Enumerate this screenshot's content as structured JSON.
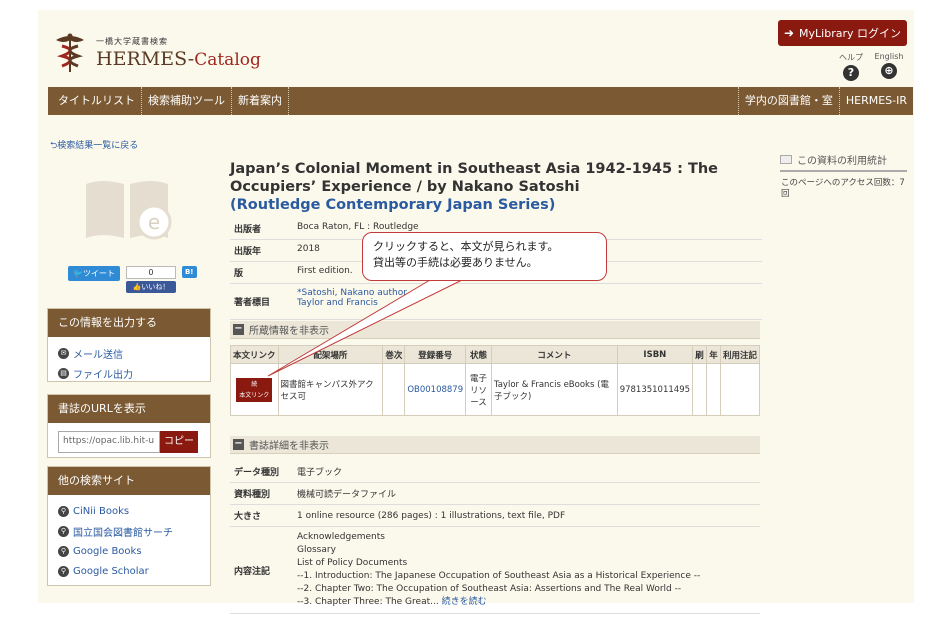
{
  "header": {
    "logo_sub": "一橋大学蔵書検索",
    "logo_main": "HERMES-",
    "logo_cat": "Catalog",
    "mylibrary_label": "MyLibrary ログイン",
    "help_label": "ヘルプ",
    "english_label": "English"
  },
  "nav": {
    "items": [
      "タイトルリスト",
      "検索補助ツール",
      "新着案内"
    ],
    "right_items": [
      "学内の図書館・室",
      "HERMES-IR"
    ]
  },
  "back_link": "検索結果一覧に戻る",
  "social": {
    "tweet": "ツイート",
    "like_count": "0",
    "like": "いいね！",
    "bookmark": "B!"
  },
  "export_panel": {
    "title": "この情報を出力する",
    "email": "メール送信",
    "file": "ファイル出力"
  },
  "url_panel": {
    "title": "書誌のURLを表示",
    "url": "https://opac.lib.hit-u",
    "copy": "コピー"
  },
  "other_panel": {
    "title": "他の検索サイト",
    "links": [
      "CiNii Books",
      "国立国会図書館サーチ",
      "Google Books",
      "Google Scholar"
    ]
  },
  "record": {
    "title": "Japan’s Colonial Moment in Southeast Asia 1942-1945 : The Occupiers’ Experience / by Nakano Satoshi",
    "series": "(Routledge Contemporary Japan Series)",
    "meta": [
      {
        "key": "出版者",
        "value": "Boca Raton, FL : Routledge"
      },
      {
        "key": "出版年",
        "value": "2018"
      },
      {
        "key": "版",
        "value": "First edition."
      }
    ],
    "author_key": "著者標目",
    "authors": [
      "*Satoshi, Nakano author",
      "Taylor and Francis"
    ]
  },
  "holdings": {
    "section_label": "所蔵情報を非表示",
    "headers": [
      "本文リンク",
      "配架場所",
      "巻次",
      "登録番号",
      "状態",
      "コメント",
      "ISBN",
      "刷",
      "年",
      "利用注記"
    ],
    "fulltext_button": "本文リンク",
    "fulltext_icon_label": "続",
    "row": {
      "location": "図書館キャンパス外アクセス可",
      "volume": "",
      "reg_no": "OB00108879",
      "status": "電子リソース",
      "comment": "Taylor & Francis eBooks (電子ブック)",
      "isbn": "9781351011495",
      "print": "",
      "year": "",
      "note": ""
    }
  },
  "details": {
    "section_label": "書誌詳細を非表示",
    "rows": [
      {
        "key": "データ種別",
        "value": "電子ブック"
      },
      {
        "key": "資料種別",
        "value": "機械可読データファイル"
      },
      {
        "key": "大きさ",
        "value": "1 online resource (286 pages) : 1 illustrations, text file, PDF"
      }
    ],
    "contents_key": "内容注記",
    "contents": [
      "Acknowledgements",
      "Glossary",
      "List of Policy Documents",
      "--1. Introduction: The Japanese Occupation of Southeast Asia as a Historical Experience --",
      "--2. Chapter Two: The Occupation of Southeast Asia: Assertions and The Real World --",
      "--3. Chapter Three: The Great..."
    ],
    "read_more": "続きを読む"
  },
  "callout": {
    "line1": "クリックすると、本文が見られます。",
    "line2": "貸出等の手続は必要ありません。"
  },
  "stats": {
    "title": "この資料の利用統計",
    "text": "このページへのアクセス回数：7回"
  }
}
